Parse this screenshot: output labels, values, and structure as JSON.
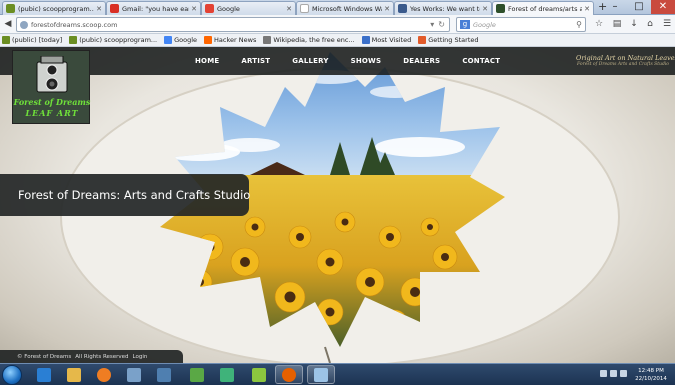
{
  "browser": {
    "tabs": [
      {
        "label": "(pubic) scoopprogram...",
        "favicon_color": "#6b8e23",
        "active": false
      },
      {
        "label": "Gmail: \"you have earned J...",
        "favicon_color": "#d93025",
        "active": false
      },
      {
        "label": "Google",
        "favicon_color": "#e34234",
        "active": false
      },
      {
        "label": "Microsoft Windows Watch J...",
        "favicon_color": "#ffffff",
        "active": false
      },
      {
        "label": "Yes Works: We want to...",
        "favicon_color": "#3a5a8c",
        "active": false
      },
      {
        "label": "Forest of dreams/arts and cra...",
        "favicon_color": "#2e4f2a",
        "active": true
      }
    ],
    "new_tab": "+",
    "window_controls": [
      "–",
      "□",
      "✕"
    ],
    "url": "forestofdreams.scoop.com",
    "search_placeholder": "Google",
    "bookmarks": [
      {
        "label": "(public) [today]",
        "icon_color": "#6b8e23"
      },
      {
        "label": "(pubic) scoopprogram...",
        "icon_color": "#6b8e23"
      },
      {
        "label": "Google",
        "icon_color": "#4285f4"
      },
      {
        "label": "Hacker News",
        "icon_color": "#ff6600"
      },
      {
        "label": "Wikipedia, the free enc...",
        "icon_color": "#777777"
      },
      {
        "label": "Most Visited",
        "icon_color": "#3a6fc9"
      },
      {
        "label": "Getting Started",
        "icon_color": "#e25b2a"
      }
    ]
  },
  "site": {
    "logo": {
      "line1": "Forest of Dreams",
      "line2": "LEAF ART"
    },
    "nav": [
      "HOME",
      "ARTIST",
      "GALLERY",
      "SHOWS",
      "DEALERS",
      "CONTACT"
    ],
    "brand_right": {
      "line1": "Original Art on Natural Leaves",
      "line2": "Forest of Dreams Arts and Crafts Studio"
    },
    "hero_caption": "Forest of Dreams: Arts and Crafts Studio",
    "footer": [
      "© Forest of Dreams",
      "All Rights Reserved",
      "Login"
    ]
  },
  "taskbar": {
    "time": "12:48 PM",
    "date": "22/10/2014",
    "pinned": [
      {
        "name": "ie-icon",
        "color": "#2a7fd4"
      },
      {
        "name": "explorer-icon",
        "color": "#e6b84a"
      },
      {
        "name": "ie-browser-icon",
        "color": "#1e88e5"
      },
      {
        "name": "media-player-icon",
        "color": "#ef7d22"
      },
      {
        "name": "tool-icon",
        "color": "#7aa1c9"
      },
      {
        "name": "calc-icon",
        "color": "#4f7fb0"
      },
      {
        "name": "app-green-icon",
        "color": "#5aa845"
      },
      {
        "name": "app-teal-icon",
        "color": "#3fb37a"
      },
      {
        "name": "app-leaf-icon",
        "color": "#8cc63f"
      },
      {
        "name": "firefox-icon",
        "color": "#e66000"
      },
      {
        "name": "app-window-icon",
        "color": "#9cc3e6"
      }
    ]
  }
}
